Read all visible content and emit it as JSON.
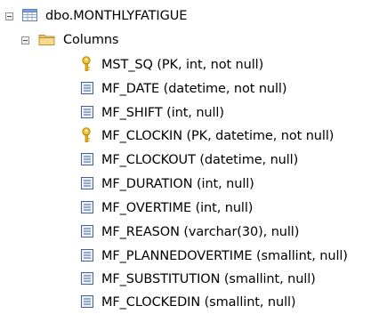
{
  "table": {
    "label": "dbo.MONTHLYFATIGUE",
    "icon": "table-icon"
  },
  "columns_folder": {
    "label": "Columns",
    "icon": "folder-icon"
  },
  "columns": [
    {
      "label": "MST_SQ (PK, int, not null)",
      "icon": "primary-key-icon"
    },
    {
      "label": "MF_DATE (datetime, not null)",
      "icon": "column-icon"
    },
    {
      "label": "MF_SHIFT (int, null)",
      "icon": "column-icon"
    },
    {
      "label": "MF_CLOCKIN (PK, datetime, not null)",
      "icon": "primary-key-icon"
    },
    {
      "label": "MF_CLOCKOUT (datetime, null)",
      "icon": "column-icon"
    },
    {
      "label": "MF_DURATION (int, null)",
      "icon": "column-icon"
    },
    {
      "label": "MF_OVERTIME (int, null)",
      "icon": "column-icon"
    },
    {
      "label": "MF_REASON (varchar(30), null)",
      "icon": "column-icon"
    },
    {
      "label": "MF_PLANNEDOVERTIME (smallint, null)",
      "icon": "column-icon"
    },
    {
      "label": "MF_SUBSTITUTION (smallint, null)",
      "icon": "column-icon"
    },
    {
      "label": "MF_CLOCKEDIN (smallint, null)",
      "icon": "column-icon"
    }
  ]
}
